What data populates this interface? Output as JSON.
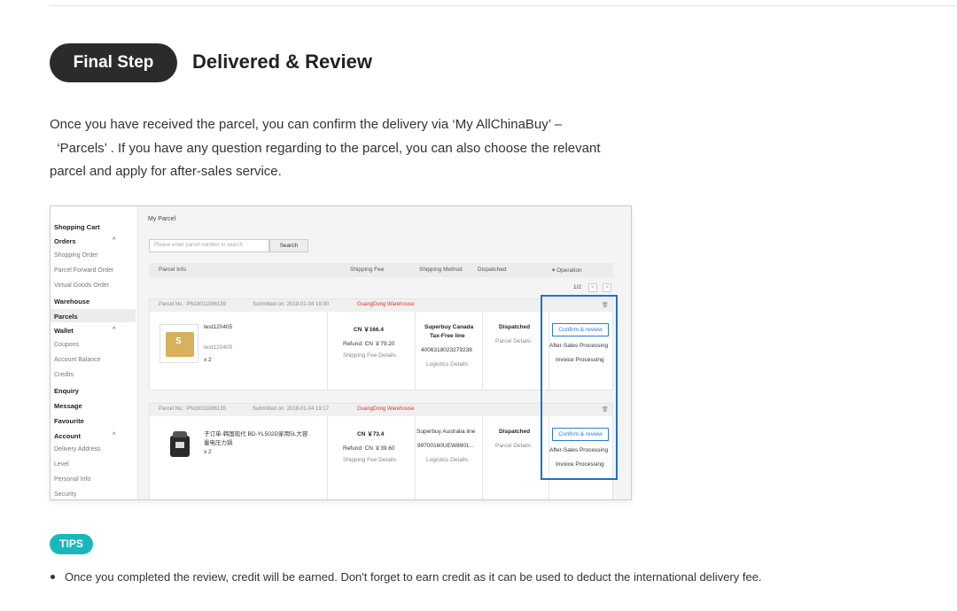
{
  "step": {
    "pill": "Final Step",
    "title": "Delivered & Review"
  },
  "intro": {
    "line1": "Once you have received the parcel, you can confirm the delivery via ‘My AllChinaBuy’  –",
    "line2": "  ‘Parcels’ . If you have any question regarding to the parcel, you can also choose the relevant",
    "line3": "parcel and apply for after-sales service."
  },
  "screenshot": {
    "sidebar": {
      "shopping_cart": "Shopping Cart",
      "orders": "Orders",
      "shopping_order": "Shopping Order",
      "parcel_forward_order": "Parcel Forward Order",
      "virtual_goods_order": "Virtual Goods Order",
      "warehouse": "Warehouse",
      "parcels": "Parcels",
      "wallet": "Wallet",
      "coupons": "Coupons",
      "account_balance": "Account Balance",
      "credits": "Credits",
      "enquiry": "Enquiry",
      "message": "Message",
      "favourite": "Favourite",
      "account": "Account",
      "delivery_address": "Delivery Address",
      "level": "Level",
      "personal_info": "Personal Info",
      "security": "Security",
      "caret": "^"
    },
    "page_title": "My Parcel",
    "search": {
      "placeholder": "Please enter parcel number to search",
      "button": "Search"
    },
    "table_headers": {
      "parcel_info": "Parcel Info",
      "shipping_fee": "Shipping Fee",
      "shipping_method": "Shipping Method",
      "dispatched": "Dispatched",
      "operation": "▾  Operation"
    },
    "pager": {
      "text": "1/2",
      "prev": "<",
      "next": ">"
    },
    "parcels": [
      {
        "parcel_no": "Parcel No.:  PN18011086139",
        "submitted": "Submitted on:  2018-01-04 19:30",
        "warehouse": "GuangDong Warehouse",
        "item_name": "test120405",
        "item_sub": "test120405",
        "qty": "x 2",
        "fee": "CN ￥166.4",
        "refund": "Refund: CN ￥79.20",
        "fee_details": "Shipping Fee Details",
        "method_line1": "Superbuy Canada",
        "method_line2": "Tax-Free line",
        "tracking": "4006318023279238",
        "logistics": "Logistics Details",
        "status": "Dispatched",
        "status_link": "Parcel Details",
        "confirm": "Confirm & review",
        "after_sales": "After-Sales Processing",
        "invoice": "Invoice Processing"
      },
      {
        "parcel_no": "Parcel No.:  PN18011086135",
        "submitted": "Submitted on:  2018-01-04 19:17",
        "warehouse": "GuangDong Warehouse",
        "item_name": "子订单-韩国现代 BD-YL502D家用5L大容",
        "item_sub": "量电压力锅",
        "qty": "x 2",
        "fee": "CN ￥73.4",
        "refund": "Refund: CN ￥39.60",
        "fee_details": "Shipping Fee Details",
        "method_line1": "Superbuy Australia line",
        "tracking": "99700160UEW8901...",
        "logistics": "Logistics Details",
        "status": "Dispatched",
        "status_link": "Parcel Details",
        "confirm": "Confirm & review",
        "after_sales": "After-Sales Processing",
        "invoice": "Invoice Processing"
      }
    ]
  },
  "tips": {
    "badge": "TIPS",
    "bullet": "Once you completed the review, credit will be earned. Don't forget to earn credit as it can be used to deduct the international delivery fee."
  },
  "colors": {
    "pill_bg": "#2b2b2b",
    "tips_bg": "#18b7bd",
    "highlight": "#1c72c9",
    "warehouse_red": "#e0322e"
  }
}
